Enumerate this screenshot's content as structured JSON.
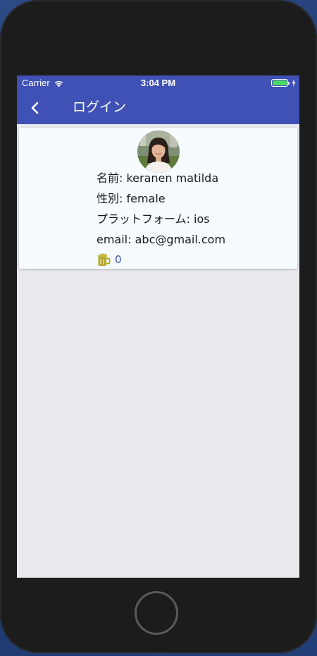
{
  "status_bar": {
    "carrier": "Carrier",
    "time": "3:04 PM",
    "battery_level": 1.0,
    "wifi_icon": "wifi-icon",
    "charging_icon": "bolt-icon"
  },
  "nav": {
    "back_icon": "chevron-left-icon",
    "title": "ログイン"
  },
  "profile": {
    "avatar_icon": "avatar",
    "name_line": "名前: keranen matilda",
    "gender_line": "性別: female",
    "platform_line": "プラットフォーム: ios",
    "email_line": "email: abc@gmail.com",
    "points_icon": "beer-mug-icon",
    "points": "0"
  },
  "colors": {
    "primary": "#3f51b5",
    "card_bg": "#f5fbff",
    "screen_bg": "#e9e9ee",
    "battery": "#4cd964",
    "beer": "#b5a830"
  }
}
